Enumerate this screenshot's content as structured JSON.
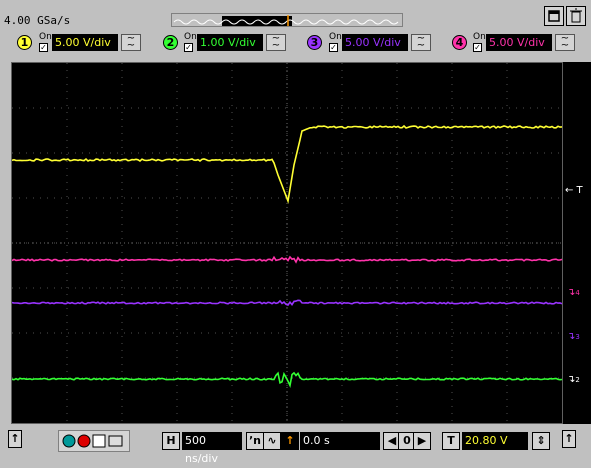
{
  "toolbar": {
    "sample_rate": "4.00 GSa/s",
    "maximize_icon": "maximize-icon",
    "trash_icon": "delete-icon"
  },
  "channels": [
    {
      "num": "1",
      "on_label": "On",
      "scale": "5.00 V/div",
      "color": "#ffff33",
      "enabled": true
    },
    {
      "num": "2",
      "on_label": "On",
      "scale": "1.00 V/div",
      "color": "#33ff33",
      "enabled": true
    },
    {
      "num": "3",
      "on_label": "On",
      "scale": "5.00 V/div",
      "color": "#9933ff",
      "enabled": true
    },
    {
      "num": "4",
      "on_label": "On",
      "scale": "5.00 V/div",
      "color": "#ff33aa",
      "enabled": true
    }
  ],
  "markers": {
    "trigger_label": "← T",
    "ch4_marker": "4",
    "ch3_marker": "3",
    "ch2_marker": "2"
  },
  "bottom": {
    "h_label": "H",
    "timebase": "500 ns/div",
    "delay": "0.0 s",
    "zero_label": "0",
    "t_label": "T",
    "trigger_level": "20.80 V",
    "scroll_up_label": "↑"
  },
  "chart_data": {
    "type": "line",
    "time_per_div": "500 ns/div",
    "x_divisions": 10,
    "y_divisions": 8,
    "grid": true,
    "series": [
      {
        "name": "1",
        "description": "step with negative dip at trigger",
        "color": "#ffff33"
      },
      {
        "name": "4",
        "description": "flat baseline with small glitch",
        "color": "#ff33aa"
      },
      {
        "name": "3",
        "description": "flat baseline with small glitch",
        "color": "#9933ff"
      },
      {
        "name": "2",
        "description": "flat baseline with burst at trigger",
        "color": "#33ff33"
      }
    ]
  }
}
